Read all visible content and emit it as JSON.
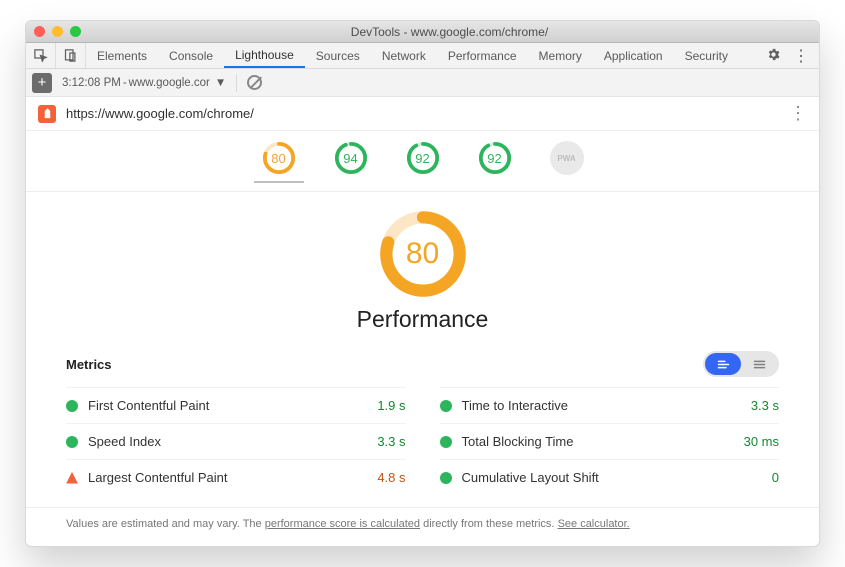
{
  "window": {
    "title": "DevTools - www.google.com/chrome/"
  },
  "tabs": {
    "items": [
      "Elements",
      "Console",
      "Lighthouse",
      "Sources",
      "Network",
      "Performance",
      "Memory",
      "Application",
      "Security"
    ],
    "active": "Lighthouse"
  },
  "subbar": {
    "time": "3:12:08 PM",
    "site": "www.google.cor"
  },
  "urlbar": {
    "url": "https://www.google.com/chrome/"
  },
  "gauges_nav": [
    {
      "score": "80",
      "color": "#f5a524",
      "pct": 0.8
    },
    {
      "score": "94",
      "color": "#2db55d",
      "pct": 0.94
    },
    {
      "score": "92",
      "color": "#2db55d",
      "pct": 0.92
    },
    {
      "score": "92",
      "color": "#2db55d",
      "pct": 0.92
    }
  ],
  "pwa_label": "PWA",
  "main": {
    "score": "80",
    "label": "Performance"
  },
  "metrics_label": "Metrics",
  "metrics": {
    "left": [
      {
        "icon": "circle",
        "name": "First Contentful Paint",
        "value": "1.9 s",
        "cls": "green"
      },
      {
        "icon": "circle",
        "name": "Speed Index",
        "value": "3.3 s",
        "cls": "green"
      },
      {
        "icon": "triangle",
        "name": "Largest Contentful Paint",
        "value": "4.8 s",
        "cls": "orange"
      }
    ],
    "right": [
      {
        "icon": "circle",
        "name": "Time to Interactive",
        "value": "3.3 s",
        "cls": "green"
      },
      {
        "icon": "circle",
        "name": "Total Blocking Time",
        "value": "30 ms",
        "cls": "green"
      },
      {
        "icon": "circle",
        "name": "Cumulative Layout Shift",
        "value": "0",
        "cls": "green"
      }
    ]
  },
  "footnote": {
    "a": "Values are estimated and may vary. The ",
    "b": "performance score is calculated",
    "c": " directly from these metrics. ",
    "d": "See calculator."
  }
}
